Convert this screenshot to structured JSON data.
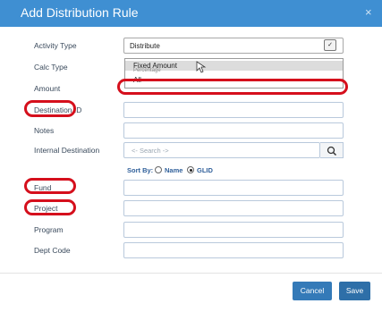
{
  "dialog": {
    "title": "Add Distribution Rule",
    "close_glyph": "×"
  },
  "form": {
    "activity_type": {
      "label": "Activity Type",
      "value": "Distribute"
    },
    "calc_type": {
      "label": "Calc Type",
      "options": [
        "Fixed Amount",
        "Percentage",
        "All"
      ]
    },
    "amount": {
      "label": "Amount"
    },
    "destination_id": {
      "label": "Destination ID"
    },
    "notes": {
      "label": "Notes"
    },
    "internal_destination": {
      "label": "Internal Destination",
      "placeholder": "<- Search ->"
    },
    "sort_by": {
      "label": "Sort By:",
      "options": [
        "Name",
        "GLID"
      ],
      "selected": "GLID"
    },
    "fund": {
      "label": "Fund"
    },
    "project": {
      "label": "Project"
    },
    "program": {
      "label": "Program"
    },
    "dept_code": {
      "label": "Dept Code"
    }
  },
  "buttons": {
    "cancel": "Cancel",
    "save": "Save"
  },
  "colors": {
    "header": "#3f8fd2",
    "highlight": "#d50f1c",
    "primary": "#347ab8"
  }
}
